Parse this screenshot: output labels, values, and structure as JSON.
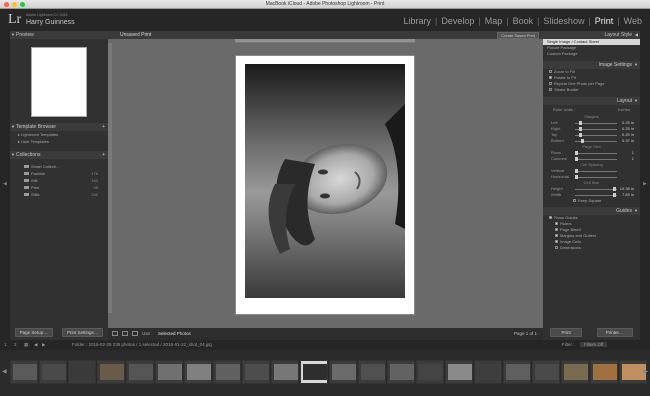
{
  "window": {
    "title": "MacBook iCloud - Adobe Photoshop Lightroom - Print"
  },
  "identity": {
    "logo": "Lr",
    "catalog": "Adobe Lightroom CC 2015",
    "user": "Harry Guinness"
  },
  "modules": [
    "Library",
    "Develop",
    "Map",
    "Book",
    "Slideshow",
    "Print",
    "Web"
  ],
  "active_module": "Print",
  "left_panel": {
    "preview_title": "Preview",
    "template_browser": {
      "title": "Template Browser",
      "items": [
        {
          "label": "Lightroom Templates"
        },
        {
          "label": "User Templates"
        }
      ]
    },
    "collections": {
      "title": "Collections",
      "items": [
        {
          "label": "Smart Collecti…",
          "count": ""
        },
        {
          "label": "Fashion",
          "count": "176"
        },
        {
          "label": "Still",
          "count": "183"
        },
        {
          "label": "Print",
          "count": "95"
        },
        {
          "label": "Stills",
          "count": "240"
        }
      ]
    },
    "page_setup": "Page Setup…",
    "print_settings": "Print Settings…"
  },
  "center": {
    "title": "Unsaved Print",
    "create_saved": "Create Saved Print",
    "use_label": "Use :",
    "use_value": "Selected Photos",
    "page_count": "Page 1 of 1"
  },
  "right_panel": {
    "layout_style": {
      "title": "Layout Style",
      "options": [
        "Single Image / Contact Sheet",
        "Picture Package",
        "Custom Package"
      ],
      "selected_index": 0
    },
    "image_settings": {
      "title": "Image Settings",
      "options": [
        {
          "label": "Zoom to Fill",
          "checked": false
        },
        {
          "label": "Rotate to Fit",
          "checked": true
        },
        {
          "label": "Repeat One Photo per Page",
          "checked": false
        },
        {
          "label": "Stroke Border",
          "checked": false
        }
      ]
    },
    "layout": {
      "title": "Layout",
      "ruler_units_label": "Ruler Units :",
      "ruler_units_value": "Inches",
      "margins_label": "Margins",
      "margins": [
        {
          "label": "Left",
          "value": "0.25 in",
          "level": 0.1
        },
        {
          "label": "Right",
          "value": "0.25 in",
          "level": 0.1
        },
        {
          "label": "Top",
          "value": "0.25 in",
          "level": 0.1
        },
        {
          "label": "Bottom",
          "value": "0.37 in",
          "level": 0.15
        }
      ],
      "page_grid_label": "Page Grid",
      "page_grid": [
        {
          "label": "Rows",
          "value": "1",
          "level": 0.0
        },
        {
          "label": "Columns",
          "value": "1",
          "level": 0.0
        }
      ],
      "cell_spacing_label": "Cell Spacing",
      "cell_spacing": [
        {
          "label": "Vertical",
          "value": "",
          "level": 0.0
        },
        {
          "label": "Horizontal",
          "value": "",
          "level": 0.0
        }
      ],
      "cell_size_label": "Cell Size",
      "cell_size": [
        {
          "label": "Height",
          "value": "10.38 in",
          "level": 0.95
        },
        {
          "label": "Width",
          "value": "7.83 in",
          "level": 0.95
        }
      ],
      "keep_square": "Keep Square"
    },
    "guides": {
      "title": "Guides",
      "show_guides": "Show Guides",
      "options": [
        "Rulers",
        "Page Bleed",
        "Margins and Gutters",
        "Image Cells",
        "Dimensions"
      ]
    },
    "print_button": "Print",
    "printer_button": "Printer…"
  },
  "filmstrip": {
    "path": "Folder : 2016-02-25    239 photos / 1 selected / 2016-01-22_shot_04.jpg",
    "filter_label": "Filter :",
    "filter_value": "Filters Off",
    "page_numbers": [
      "1",
      "2"
    ]
  }
}
